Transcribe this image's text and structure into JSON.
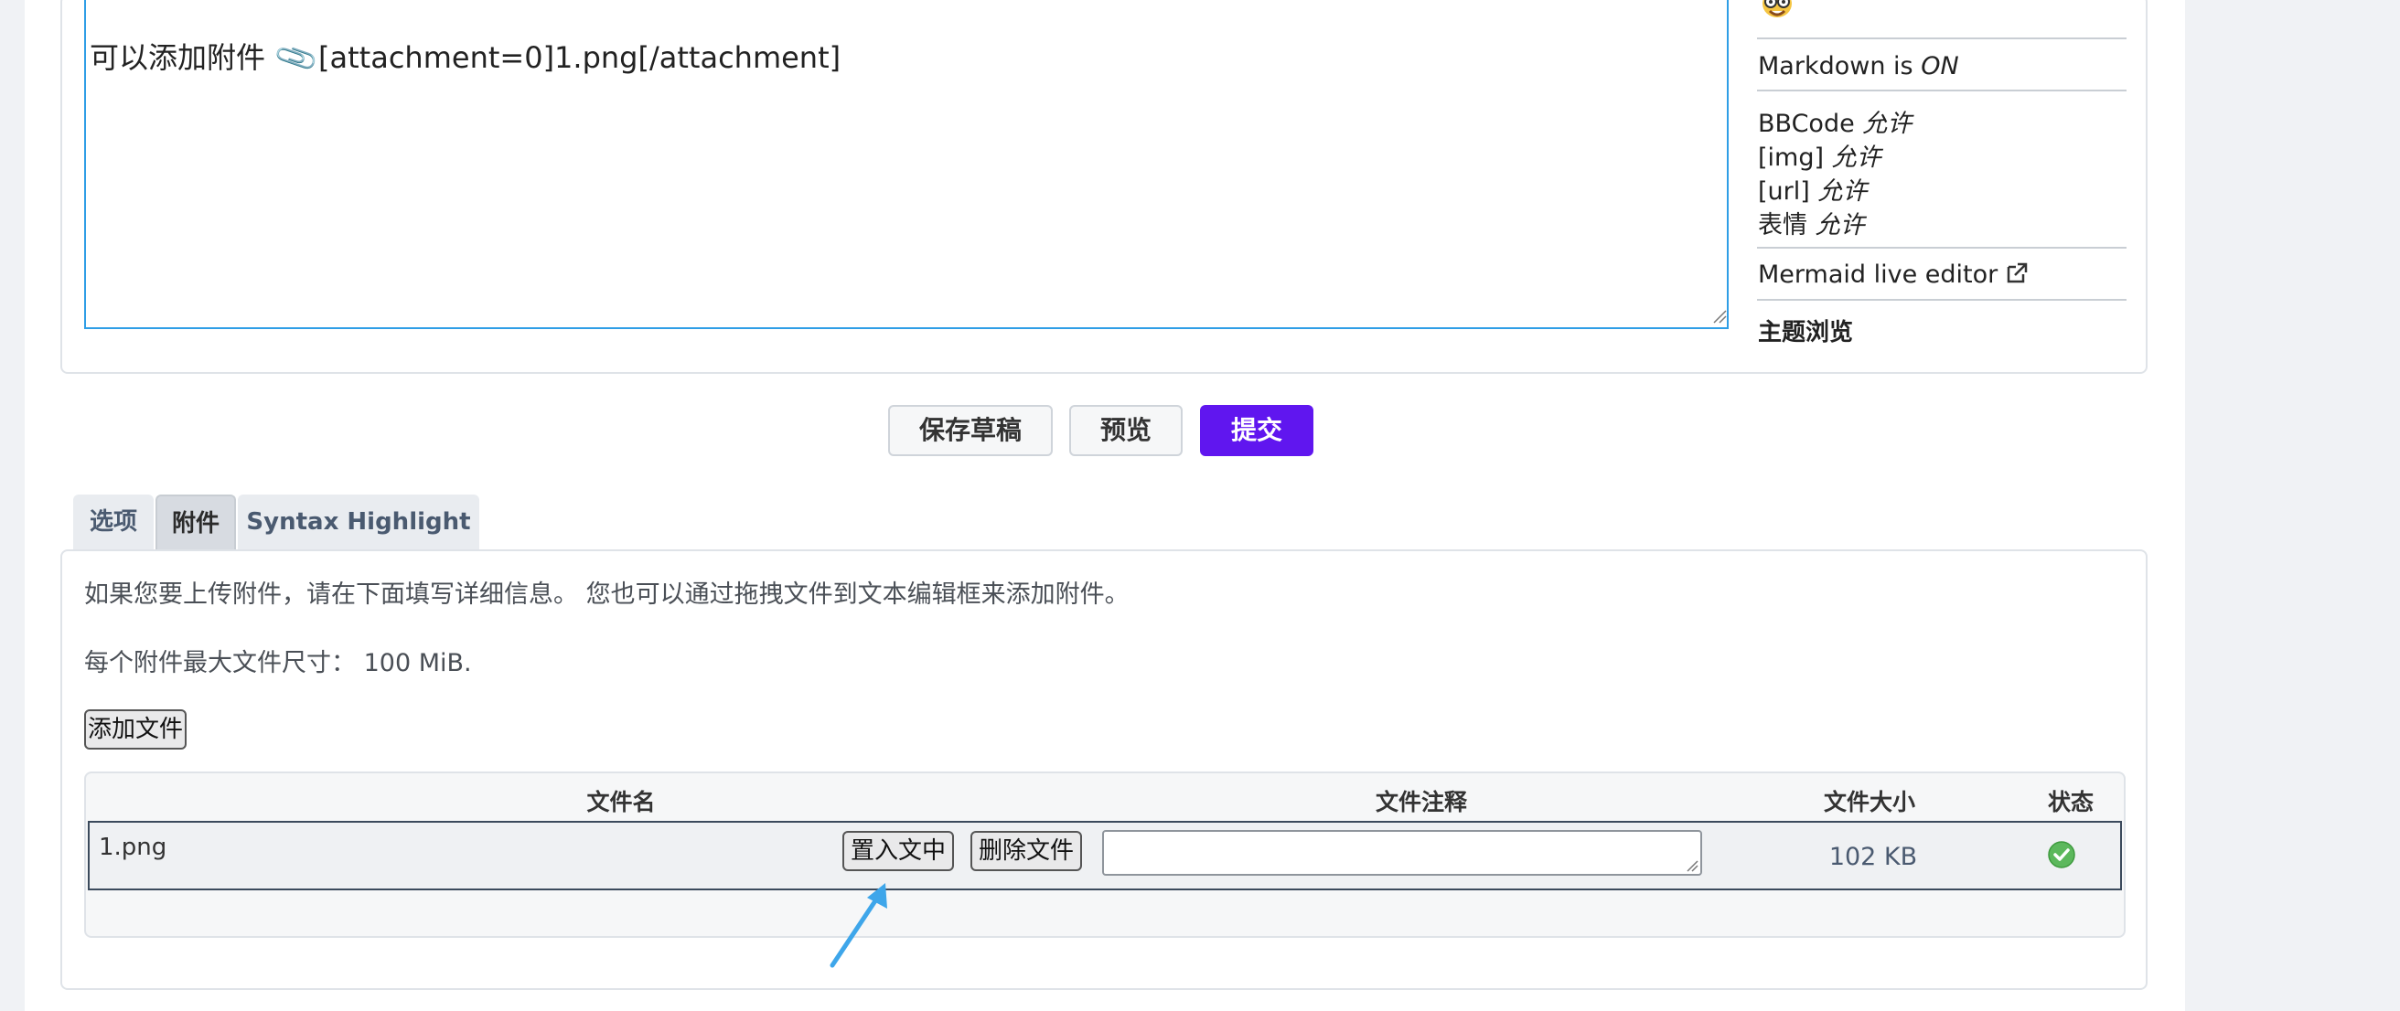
{
  "editor": {
    "text_before": "可以添加附件",
    "clip_glyph": "📎",
    "text_after": "[attachment=0]1.png[/attachment]"
  },
  "sidebar": {
    "avatar_icon": "nerd-face-icon",
    "markdown_label": "Markdown is",
    "markdown_state": "ON",
    "bbcode_label": "BBCode",
    "bbcode_state": "允许",
    "img_label": "[img]",
    "img_state": "允许",
    "url_label": "[url]",
    "url_state": "允许",
    "smilies_label": "表情",
    "smilies_state": "允许",
    "mermaid_link": "Mermaid live editor",
    "mermaid_icon": "external-link-icon",
    "topic_review": "主题浏览"
  },
  "actions": {
    "save_draft": "保存草稿",
    "preview": "预览",
    "submit": "提交",
    "accent_color": "#6016ef"
  },
  "tabs": [
    {
      "label": "选项",
      "active": false
    },
    {
      "label": "附件",
      "active": true
    },
    {
      "label": "Syntax Highlight",
      "active": false
    }
  ],
  "attachments": {
    "info_line": "如果您要上传附件，请在下面填写详细信息。 您也可以通过拖拽文件到文本编辑框来添加附件。",
    "max_size_label": "每个附件最大文件尺寸：",
    "max_size_value": "100 MiB.",
    "add_file_button": "添加文件",
    "columns": [
      "文件名",
      "文件注释",
      "文件大小",
      "状态"
    ],
    "rows": [
      {
        "filename": "1.png",
        "place_inline": "置入文中",
        "delete": "删除文件",
        "comment": "",
        "size": "102 KB",
        "status_icon": "check-circle-icon",
        "status_color": "#5cb85c"
      }
    ]
  },
  "annotation": {
    "arrow_icon": "pointer-arrow-icon",
    "arrow_color": "#3ea6ea"
  }
}
